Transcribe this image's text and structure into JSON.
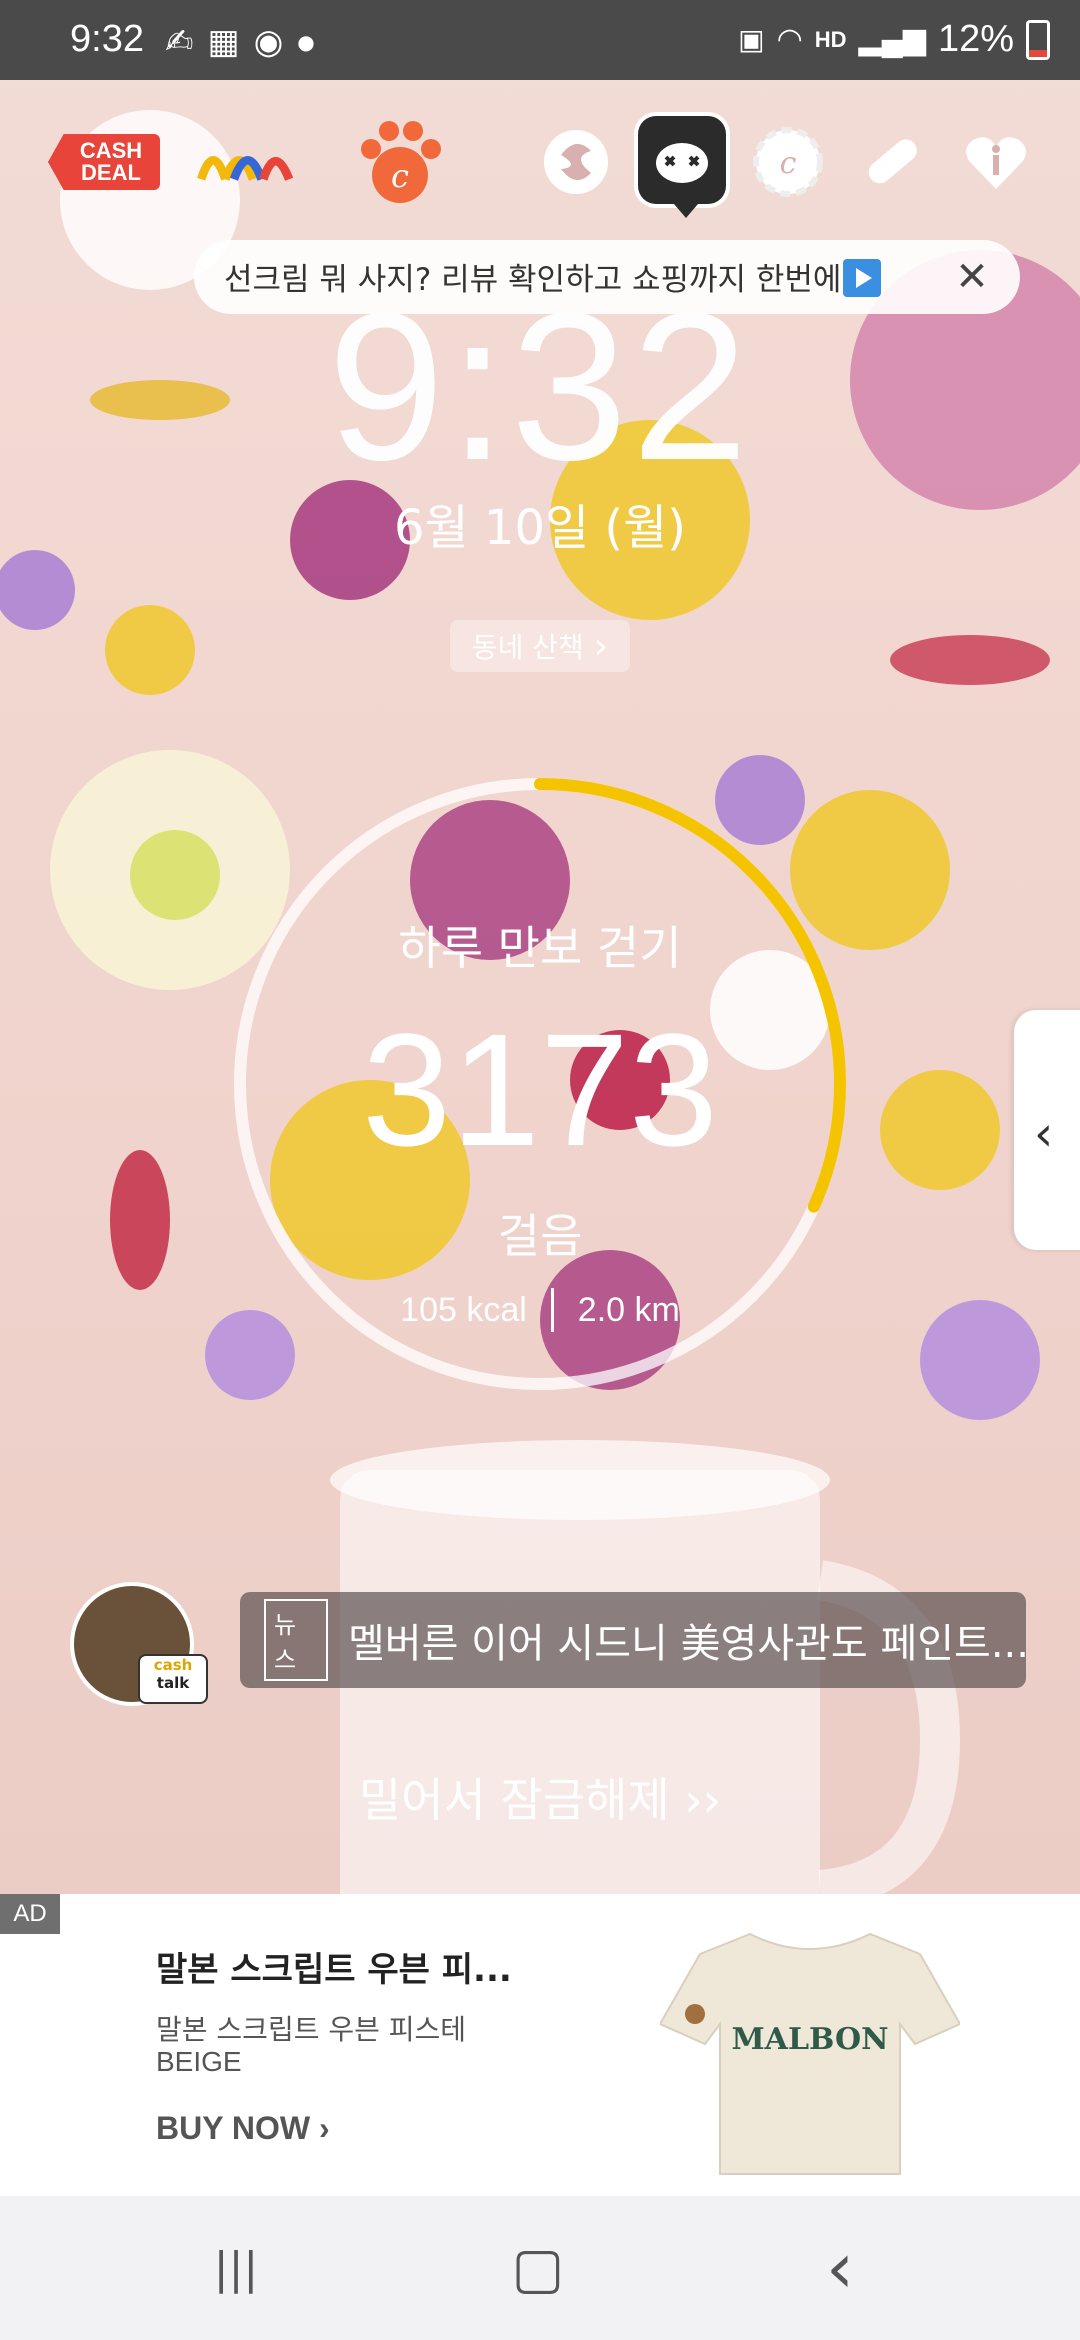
{
  "status_bar": {
    "time": "9:32",
    "network": "HD",
    "battery": "12%"
  },
  "top_apps": [
    {
      "name": "cashdeal",
      "label_line1": "CASH",
      "label_line2": "DEAL"
    }
  ],
  "banner": {
    "text": "선크림 뭐 사지? 리뷰 확인하고 쇼핑까지 한번에",
    "close_glyph": "✕"
  },
  "clock": {
    "time": "9:32",
    "date": "6월 10일 (월)"
  },
  "walk_chip": {
    "label": "동네 산책",
    "chevron": "›"
  },
  "steps": {
    "title": "하루 만보 걷기",
    "count": "3173",
    "unit": "걸음",
    "kcal": "105 kcal",
    "distance": "2.0 km",
    "progress": 0.317,
    "ring_color": "#f5c400"
  },
  "side_handle": {
    "glyph": "‹"
  },
  "news": {
    "tag": "뉴스",
    "text": "멜버른 이어 시드니 美영사관도 페인트...",
    "avatar_badge_line1": "cash",
    "avatar_badge_line2": "talk"
  },
  "unlock": {
    "label": "밀어서 잠금해제 ››"
  },
  "ad": {
    "tag": "AD",
    "title": "말본 스크립트 우븐 피...",
    "subtitle1": "말본 스크립트 우븐 피스테",
    "subtitle2": "BEIGE",
    "cta": "BUY NOW ›",
    "product_print": "MALBON"
  },
  "navbar": {
    "recents": "|||",
    "home": "▢",
    "back": "‹"
  }
}
